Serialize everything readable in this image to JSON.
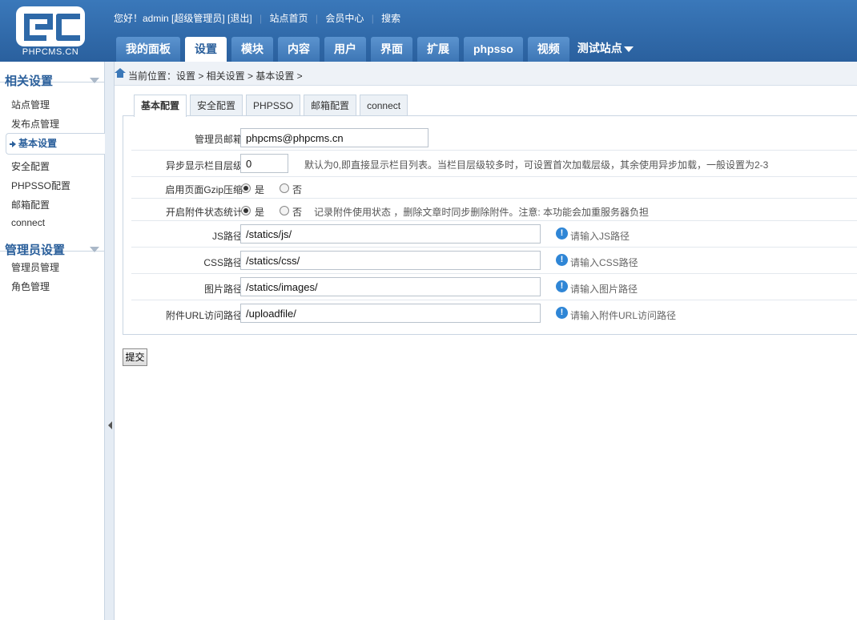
{
  "header": {
    "logo_text": "PHPCMS.CN",
    "greeting": "您好！admin [超级管理员]",
    "logout": "[退出]",
    "links": [
      "站点首页",
      "会员中心",
      "搜索"
    ],
    "nav": [
      {
        "label": "我的面板",
        "active": false
      },
      {
        "label": "设置",
        "active": true
      },
      {
        "label": "模块",
        "active": false
      },
      {
        "label": "内容",
        "active": false
      },
      {
        "label": "用户",
        "active": false
      },
      {
        "label": "界面",
        "active": false
      },
      {
        "label": "扩展",
        "active": false
      },
      {
        "label": "phpsso",
        "active": false
      },
      {
        "label": "视频",
        "active": false
      }
    ],
    "site_selector": "测试站点"
  },
  "sidebar": {
    "groups": [
      {
        "title": "相关设置",
        "items": [
          {
            "label": "站点管理",
            "active": false
          },
          {
            "label": "发布点管理",
            "active": false
          },
          {
            "label": "基本设置",
            "active": true
          },
          {
            "label": "安全配置",
            "active": false
          },
          {
            "label": "PHPSSO配置",
            "active": false
          },
          {
            "label": "邮箱配置",
            "active": false
          },
          {
            "label": "connect",
            "active": false
          }
        ]
      },
      {
        "title": "管理员设置",
        "items": [
          {
            "label": "管理员管理",
            "active": false
          },
          {
            "label": "角色管理",
            "active": false
          }
        ]
      }
    ]
  },
  "breadcrumb": "当前位置：设置 > 相关设置 > 基本设置 >",
  "tabs": [
    {
      "label": "基本配置",
      "active": true
    },
    {
      "label": "安全配置",
      "active": false
    },
    {
      "label": "PHPSSO",
      "active": false
    },
    {
      "label": "邮箱配置",
      "active": false
    },
    {
      "label": "connect",
      "active": false
    }
  ],
  "form": {
    "admin_email": {
      "label": "管理员邮箱",
      "value": "phpcms@phpcms.cn"
    },
    "category_levels": {
      "label": "异步显示栏目层级",
      "value": "0",
      "hint": "默认为0,即直接显示栏目列表。当栏目层级较多时，可设置首次加载层级，其余使用异步加载，一般设置为2-3"
    },
    "gzip": {
      "label": "启用页面Gzip压缩",
      "yes": "是",
      "no": "否",
      "selected": "yes"
    },
    "attachment_stat": {
      "label": "开启附件状态统计",
      "yes": "是",
      "no": "否",
      "selected": "yes",
      "hint": "记录附件使用状态 ，删除文章时同步删除附件。注意: 本功能会加重服务器负担"
    },
    "js_path": {
      "label": "JS路径",
      "value": "/statics/js/",
      "tip": "请输入JS路径"
    },
    "css_path": {
      "label": "CSS路径",
      "value": "/statics/css/",
      "tip": "请输入CSS路径"
    },
    "img_path": {
      "label": "图片路径",
      "value": "/statics/images/",
      "tip": "请输入图片路径"
    },
    "upload_url": {
      "label": "附件URL访问路径",
      "value": "/uploadfile/",
      "tip": "请输入附件URL访问路径"
    },
    "submit": "提交"
  },
  "colors": {
    "header_blue": "#2e69a8",
    "accent": "#2a5f9b",
    "info_icon": "#2f86d6"
  },
  "icons": {
    "home": "home-icon",
    "info": "info-icon",
    "caret": "caret-down-icon",
    "collapse": "collapse-arrow-icon"
  }
}
